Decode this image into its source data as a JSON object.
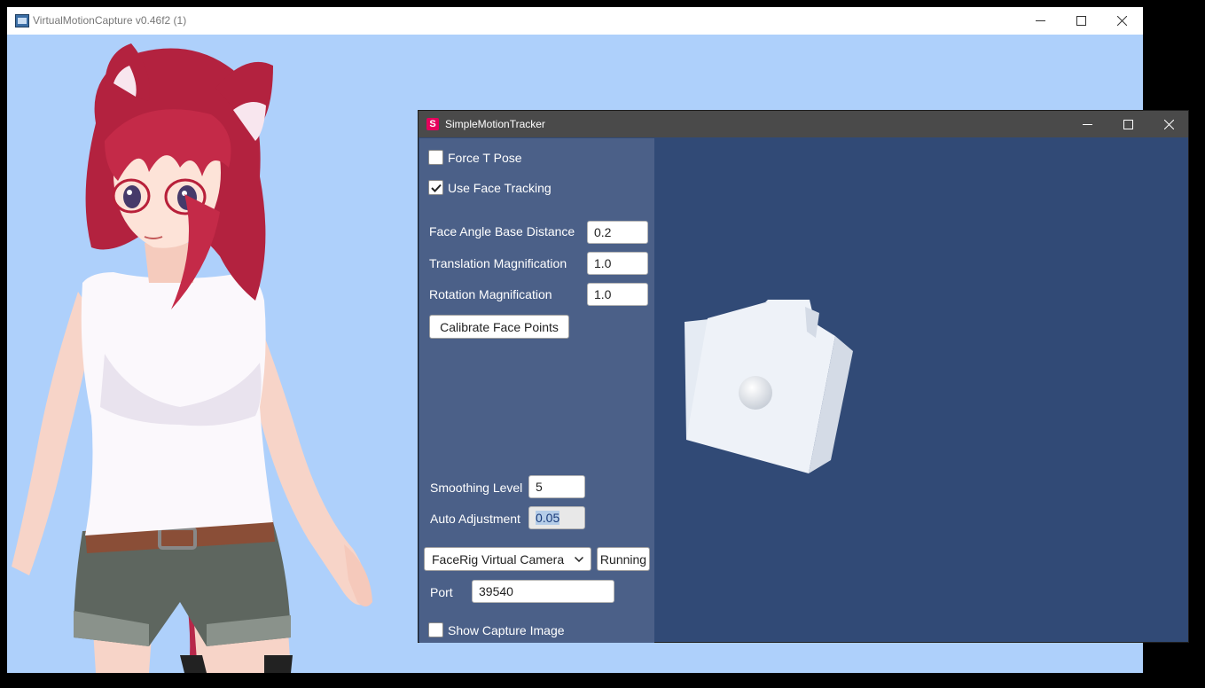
{
  "vmc_window": {
    "title": "VirtualMotionCapture v0.46f2 (1)",
    "background": "#aed0fb"
  },
  "tracker_window": {
    "title": "SimpleMotionTracker",
    "icon_letter": "S",
    "force_t_pose": {
      "label": "Force T Pose",
      "checked": false
    },
    "use_face_tracking": {
      "label": "Use Face Tracking",
      "checked": true
    },
    "face_angle_base_distance": {
      "label": "Face Angle Base Distance",
      "value": "0.2"
    },
    "translation_magnification": {
      "label": "Translation Magnification",
      "value": "1.0"
    },
    "rotation_magnification": {
      "label": "Rotation Magnification",
      "value": "1.0"
    },
    "calibrate_button": "Calibrate Face Points",
    "smoothing_level": {
      "label": "Smoothing Level",
      "value": "5"
    },
    "auto_adjustment": {
      "label": "Auto Adjustment",
      "value": "0.05"
    },
    "camera_select": {
      "selected": "FaceRig Virtual Camera"
    },
    "running_button": "Running",
    "port": {
      "label": "Port",
      "value": "39540"
    },
    "show_capture_image": {
      "label": "Show Capture Image",
      "checked": false
    },
    "panel_color": "#4b6088",
    "scene_color": "#314a76"
  },
  "icons": [
    "minimize-icon",
    "maximize-icon",
    "close-icon",
    "checkmark-icon",
    "chevron-down-icon"
  ]
}
